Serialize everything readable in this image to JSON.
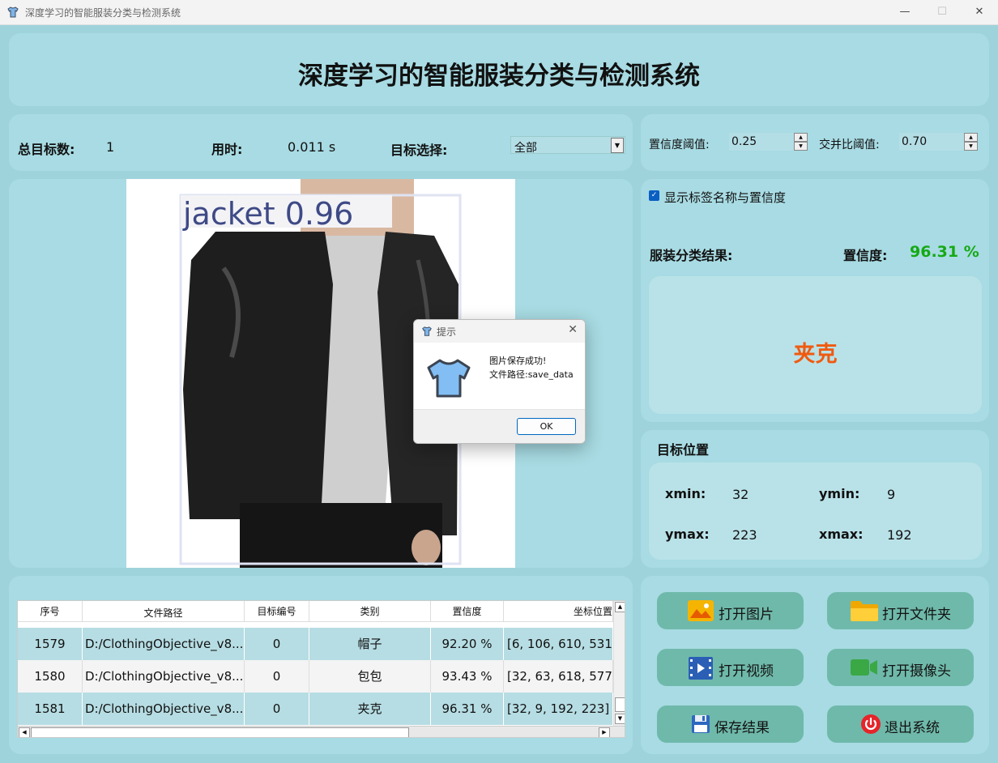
{
  "window": {
    "title": "深度学习的智能服装分类与检测系统",
    "min": "—",
    "max": "☐",
    "close": "✕"
  },
  "header": {
    "title": "深度学习的智能服装分类与检测系统"
  },
  "stats": {
    "total_label": "总目标数:",
    "total_value": "1",
    "time_label": "用时:",
    "time_value": "0.011 s",
    "target_label": "目标选择:",
    "target_value": "全部"
  },
  "thresholds": {
    "conf_label": "置信度阈值:",
    "conf_value": "0.25",
    "iou_label": "交并比阈值:",
    "iou_value": "0.70"
  },
  "image": {
    "detection_label": "jacket  0.96"
  },
  "options": {
    "show_label": "显示标签名称与置信度",
    "show_checked": true
  },
  "classification": {
    "result_label": "服装分类结果:",
    "conf_label": "置信度:",
    "conf_value": "96.31 %",
    "class_name": "夹克",
    "conf_color": "#15a915",
    "class_color": "#f05a10"
  },
  "position": {
    "title": "目标位置",
    "xmin_label": "xmin:",
    "xmin": "32",
    "ymin_label": "ymin:",
    "ymin": "9",
    "ymax_label": "ymax:",
    "ymax": "223",
    "xmax_label": "xmax:",
    "xmax": "192"
  },
  "dialog": {
    "title": "提示",
    "line1": "图片保存成功!",
    "line2": "文件路径:save_data",
    "ok": "OK"
  },
  "table": {
    "headers": [
      "序号",
      "文件路径",
      "目标编号",
      "类别",
      "置信度",
      "坐标位置"
    ],
    "rows": [
      [
        "1579",
        "D:/ClothingObjective_v8...",
        "0",
        "帽子",
        "92.20 %",
        "[6, 106, 610, 531]"
      ],
      [
        "1580",
        "D:/ClothingObjective_v8...",
        "0",
        "包包",
        "93.43 %",
        "[32, 63, 618, 577]"
      ],
      [
        "1581",
        "D:/ClothingObjective_v8...",
        "0",
        "夹克",
        "96.31 %",
        "[32, 9, 192, 223]"
      ]
    ]
  },
  "buttons": {
    "open_image": "打开图片",
    "open_folder": "打开文件夹",
    "open_video": "打开视频",
    "open_camera": "打开摄像头",
    "save": "保存结果",
    "exit": "退出系统"
  }
}
